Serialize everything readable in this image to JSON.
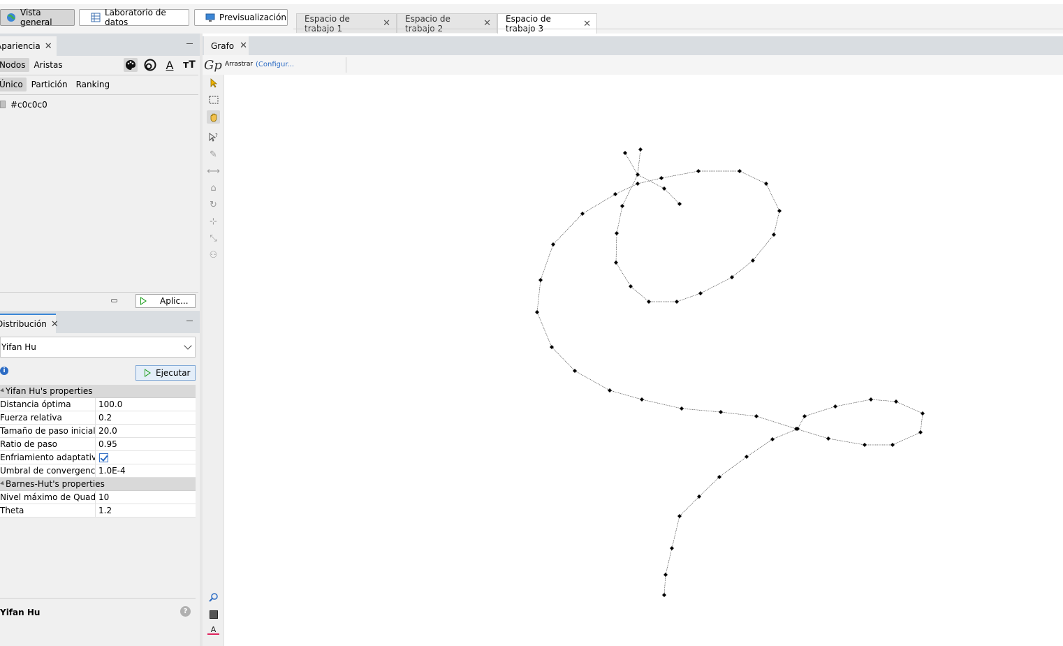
{
  "topbar": {
    "modes": [
      {
        "label": "Vista general",
        "icon": "globe-icon",
        "active": true
      },
      {
        "label": "Laboratorio de datos",
        "icon": "table-icon",
        "active": false
      },
      {
        "label": "Previsualización",
        "icon": "monitor-icon",
        "active": false
      }
    ],
    "workspaces": [
      {
        "label": "Espacio de trabajo 1",
        "active": false
      },
      {
        "label": "Espacio de trabajo 2",
        "active": false
      },
      {
        "label": "Espacio de trabajo 3",
        "active": true
      }
    ]
  },
  "appearance": {
    "tab_label": "Apariencia",
    "element_tabs": [
      "Nodos",
      "Aristas"
    ],
    "mode_tabs": [
      "Único",
      "Partición",
      "Ranking"
    ],
    "tool_icons": [
      "palette-icon",
      "size-icon",
      "label-color-icon",
      "label-size-icon"
    ],
    "color_value": "#c0c0c0",
    "apply_label": "Aplic..."
  },
  "layout": {
    "tab_label": "Distribución",
    "algorithm": "Yifan Hu",
    "run_label": "Ejecutar",
    "groups": [
      {
        "title": "Yifan Hu's properties",
        "rows": [
          {
            "key": "Distancia óptima",
            "value": "100.0"
          },
          {
            "key": "Fuerza relativa",
            "value": "0.2"
          },
          {
            "key": "Tamaño de paso inicial",
            "value": "20.0"
          },
          {
            "key": "Ratio de paso",
            "value": "0.95"
          },
          {
            "key": "Enfriamiento adaptativo",
            "value": true
          },
          {
            "key": "Umbral de convergencia",
            "value": "1.0E-4"
          }
        ]
      },
      {
        "title": "Barnes-Hut's properties",
        "rows": [
          {
            "key": "Nivel máximo de Quadtree",
            "value": "10"
          },
          {
            "key": "Theta",
            "value": "1.2"
          }
        ]
      }
    ],
    "description_title": "Yifan Hu"
  },
  "graph": {
    "tab_label": "Grafo",
    "mode_label": "Arrastrar",
    "config_link": "(Configur...",
    "tools": [
      "select-pointer-icon",
      "rectangle-select-icon",
      "drag-hand-icon",
      "inspect-icon",
      "painter-icon",
      "shortest-path-icon",
      "heatmap-icon",
      "rotate-icon",
      "add-node-icon",
      "add-edge-icon",
      "edit-graph-icon"
    ],
    "bottom_tools": [
      "zoom-icon",
      "background-color-icon",
      "font-color-icon"
    ],
    "node_color": "#000000",
    "edge_color": "#555555"
  }
}
